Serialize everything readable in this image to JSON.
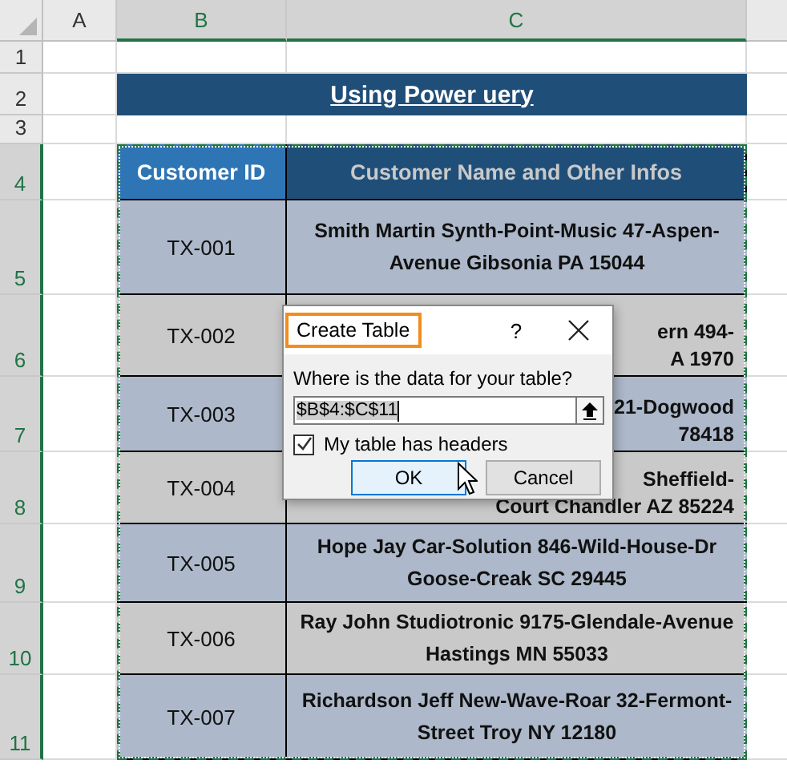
{
  "column_headers": [
    {
      "label": "A",
      "selected": false
    },
    {
      "label": "B",
      "selected": true
    },
    {
      "label": "C",
      "selected": true
    }
  ],
  "row_headers": [
    {
      "label": "1",
      "selected": false
    },
    {
      "label": "2",
      "selected": false
    },
    {
      "label": "3",
      "selected": false
    },
    {
      "label": "4",
      "selected": true
    },
    {
      "label": "5",
      "selected": true
    },
    {
      "label": "6",
      "selected": true
    },
    {
      "label": "7",
      "selected": true
    },
    {
      "label": "8",
      "selected": true
    },
    {
      "label": "9",
      "selected": true
    },
    {
      "label": "10",
      "selected": true
    },
    {
      "label": "11",
      "selected": true
    }
  ],
  "title": "Using Power uery",
  "table": {
    "columns": [
      "Customer ID",
      "Customer Name and Other Infos"
    ],
    "rows": [
      {
        "id": "TX-001",
        "info": "Smith Martin Synth-Point-Music 47-Aspen-Avenue Gibsonia PA 15044"
      },
      {
        "id": "TX-002",
        "info_fragments": [
          "ern 494-",
          "A 1970"
        ]
      },
      {
        "id": "TX-003",
        "info_fragments": [
          "21-Dogwood",
          "78418"
        ]
      },
      {
        "id": "TX-004",
        "info_fragments": [
          "Sheffield-",
          "Court Chandler AZ 85224"
        ]
      },
      {
        "id": "TX-005",
        "info": "Hope Jay Car-Solution 846-Wild-House-Dr Goose-Creak SC 29445"
      },
      {
        "id": "TX-006",
        "info": "Ray John Studiotronic 9175-Glendale-Avenue Hastings MN 55033"
      },
      {
        "id": "TX-007",
        "info": "Richardson Jeff New-Wave-Roar 32-Fermont-Street Troy NY 12180"
      }
    ]
  },
  "dialog": {
    "title": "Create Table",
    "help": "?",
    "prompt": "Where is the data for your table?",
    "range_value": "$B$4:$C$11",
    "headers_checkbox": {
      "label": "My table has headers",
      "checked": true
    },
    "buttons": [
      {
        "label": "OK",
        "focused": true
      },
      {
        "label": "Cancel",
        "focused": false
      }
    ]
  }
}
